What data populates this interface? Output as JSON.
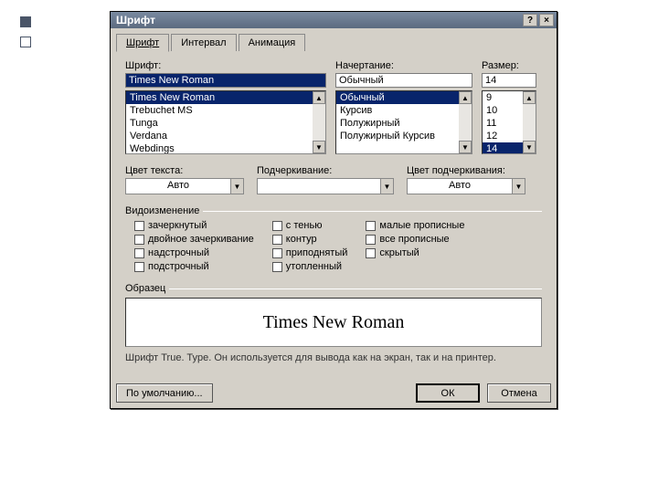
{
  "titlebar": {
    "title": "Шрифт"
  },
  "tabs": [
    "Шрифт",
    "Интервал",
    "Анимация"
  ],
  "labels": {
    "font": "Шрифт:",
    "style": "Начертание:",
    "size": "Размер:",
    "textcolor": "Цвет текста:",
    "underline": "Подчеркивание:",
    "undercolor": "Цвет подчеркивания:",
    "effects": "Видоизменение",
    "sample": "Образец"
  },
  "font": {
    "value": "Times New Roman",
    "list": [
      "Times New Roman",
      "Trebuchet MS",
      "Tunga",
      "Verdana",
      "Webdings"
    ]
  },
  "style": {
    "value": "Обычный",
    "list": [
      "Обычный",
      "Курсив",
      "Полужирный",
      "Полужирный Курсив"
    ]
  },
  "size": {
    "value": "14",
    "list": [
      "9",
      "10",
      "11",
      "12",
      "14"
    ]
  },
  "textcolor": {
    "value": "Авто"
  },
  "underline": {
    "value": ""
  },
  "undercolor": {
    "value": "Авто"
  },
  "effects": {
    "col1": [
      "зачеркнутый",
      "двойное зачеркивание",
      "надстрочный",
      "подстрочный"
    ],
    "col2": [
      "с тенью",
      "контур",
      "приподнятый",
      "утопленный"
    ],
    "col3": [
      "малые прописные",
      "все прописные",
      "скрытый"
    ]
  },
  "preview": "Times New Roman",
  "footnote": "Шрифт True. Type. Он используется для вывода как на экран, так и на принтер.",
  "buttons": {
    "default": "По умолчанию...",
    "ok": "ОК",
    "cancel": "Отмена"
  }
}
